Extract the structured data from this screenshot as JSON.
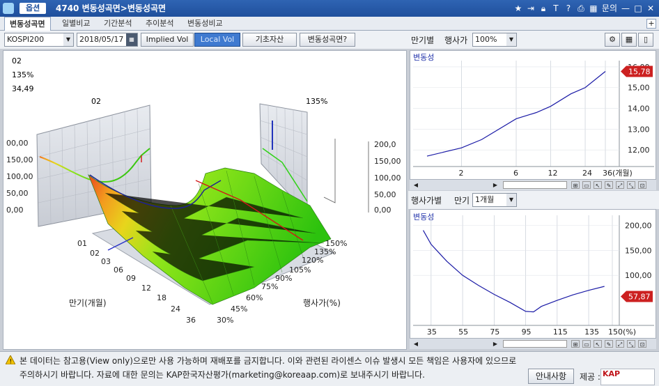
{
  "window": {
    "menu_tag": "옵션",
    "title": "4740 변동성곡면>변동성곡면",
    "icons": [
      "star-icon",
      "export-icon",
      "lock-icon",
      "text-icon",
      "help-icon",
      "print-icon",
      "layout-icon",
      "menu-icon",
      "minimize-icon",
      "maximize-icon",
      "close-icon"
    ],
    "inquiry_label": "문의"
  },
  "tabs": [
    {
      "label": "변동성곡면",
      "active": true
    },
    {
      "label": "일별비교"
    },
    {
      "label": "기간분석"
    },
    {
      "label": "추이분석"
    },
    {
      "label": "변동성비교"
    }
  ],
  "toolbar": {
    "index_select": "KOSPI200",
    "date": "2018/05/17",
    "implied_vol": "Implied Vol",
    "local_vol": "Local Vol",
    "underlying": "기초자산",
    "surface_help": "변동성곡면?"
  },
  "surface": {
    "readout": {
      "maturity": "02",
      "moneyness": "135%",
      "value": "34,49"
    },
    "left_panel_label": "02",
    "right_panel_label": "135%",
    "left_z_ticks": [
      "00,00",
      "150,00",
      "100,00",
      "50,00",
      "0,00"
    ],
    "right_z_ticks": [
      "200,0",
      "150,00",
      "100,00",
      "50,00",
      "0,00"
    ],
    "maturity_ticks": [
      "01",
      "02",
      "03",
      "06",
      "09",
      "12",
      "18",
      "24",
      "36"
    ],
    "maturity_label": "만기(개월)",
    "strike_ticks": [
      "30%",
      "45%",
      "60%",
      "75%",
      "90%",
      "105%",
      "120%",
      "135%",
      "150%"
    ],
    "strike_label": "행사가(%)"
  },
  "term_panel": {
    "header_label": "만기별",
    "strike_label": "행사가",
    "strike_value": "100%",
    "icons": [
      "gear-icon",
      "table-icon",
      "battery-icon"
    ]
  },
  "term_chart": {
    "title": "변동성",
    "current_value": "15,78",
    "colors": {
      "line": "#1a1aa6",
      "badge": "#cc2020"
    }
  },
  "smile_panel": {
    "header_label": "행사가별",
    "maturity_label": "만기",
    "maturity_value": "1개월"
  },
  "smile_chart": {
    "title": "변동성",
    "current_value": "57,87",
    "colors": {
      "line": "#1a1aa6",
      "badge": "#cc2020"
    }
  },
  "chart_data": [
    {
      "type": "line",
      "title": "변동성",
      "x": [
        "1",
        "2",
        "3",
        "6",
        "9",
        "12",
        "18",
        "24",
        "36"
      ],
      "values": [
        11.7,
        12.1,
        12.5,
        13.5,
        13.8,
        14.1,
        14.7,
        15.0,
        15.78
      ],
      "xlabel": "",
      "x_ticks": [
        "2",
        "6",
        "12",
        "24",
        "36(개월)"
      ],
      "y_ticks": [
        "12,00",
        "13,00",
        "14,00",
        "15,00",
        "16,00"
      ],
      "ylim": [
        11.2,
        16.3
      ],
      "grid": true
    },
    {
      "type": "line",
      "title": "변동성",
      "x": [
        30,
        35,
        45,
        55,
        65,
        75,
        85,
        95,
        100,
        105,
        115,
        125,
        135,
        145
      ],
      "values": [
        190,
        162,
        128,
        100,
        80,
        62,
        46,
        28,
        27,
        38,
        50,
        61,
        70,
        78
      ],
      "x_ticks": [
        "35",
        "55",
        "75",
        "95",
        "115",
        "135",
        "150(%)"
      ],
      "y_ticks": [
        "200,00",
        "150,00",
        "100,00",
        "57,87"
      ],
      "xlim": [
        28,
        150
      ],
      "ylim": [
        0,
        220
      ],
      "grid": true
    }
  ],
  "footer": {
    "line1": "본 데이터는 참고용(View only)으로만 사용 가능하며 재배포를 금지합니다. 이와 관련된 라이센스 이슈 발생시 모든 책임은 사용자에 있으므로",
    "line2": "주의하시기 바랍니다. 자료에 대한 문의는 KAP한국자산평가(marketing@koreaap.com)로 보내주시기 바랍니다.",
    "guide_button": "안내사항",
    "provider_label": "제공 :",
    "logo_text": "KAP 한국자산평가"
  }
}
